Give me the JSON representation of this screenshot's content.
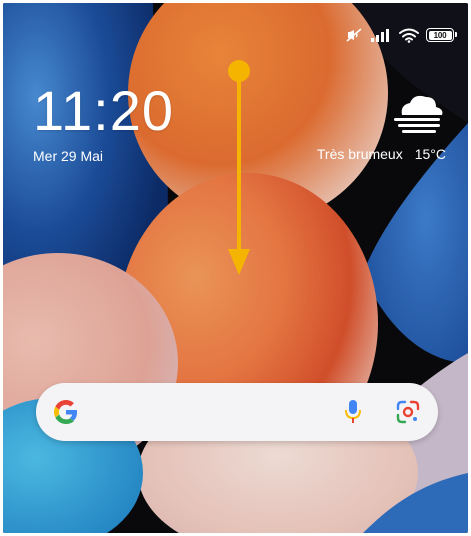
{
  "status_bar": {
    "icons": [
      "mute-icon",
      "signal-icon",
      "wifi-icon",
      "battery-icon"
    ],
    "battery_level": 100,
    "battery_label": "100"
  },
  "lock_screen": {
    "time": "11:20",
    "date": "Mer 29 Mai"
  },
  "weather": {
    "icon": "fog-icon",
    "condition": "Très brumeux",
    "temperature": "15°C"
  },
  "gesture_hint": {
    "icon": "swipe-down-arrow-icon",
    "color": "#F4B400"
  },
  "search_bar": {
    "logo": "google-g-icon",
    "mic_icon": "microphone-icon",
    "lens_icon": "google-lens-icon",
    "colors": {
      "blue": "#4285F4",
      "red": "#EA4335",
      "yellow": "#FBBC05",
      "green": "#34A853"
    }
  }
}
